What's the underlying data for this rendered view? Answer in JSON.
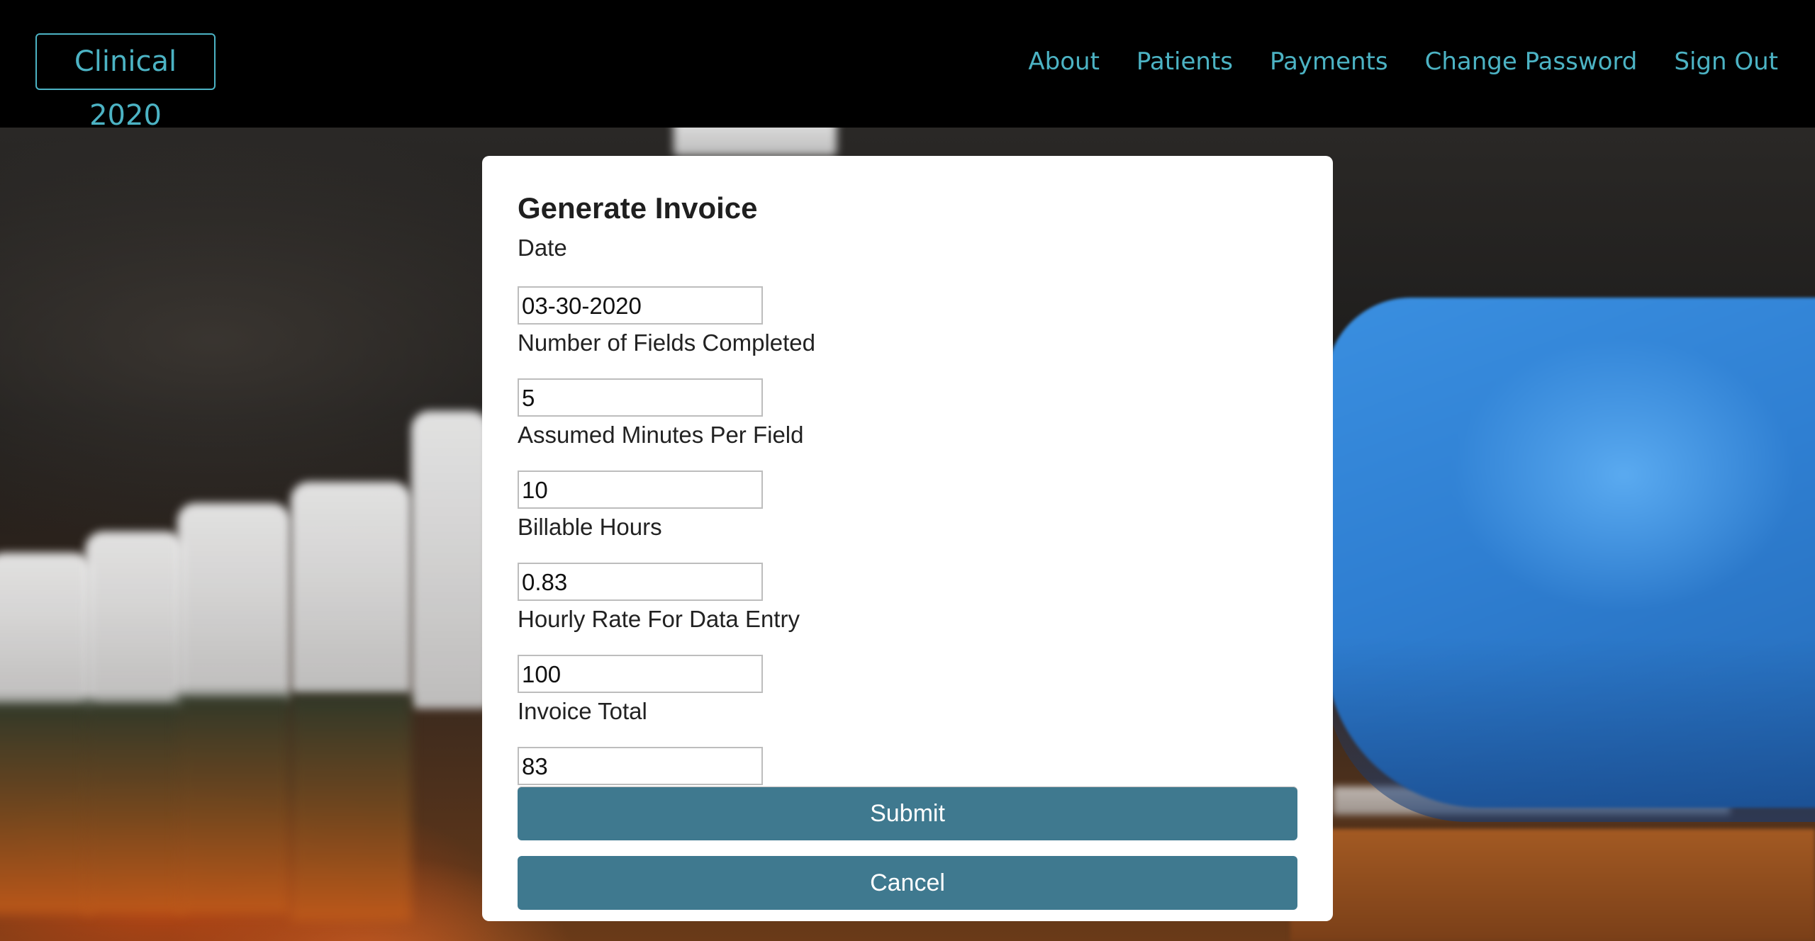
{
  "navbar": {
    "brand": "Clinical 2020",
    "links": [
      "About",
      "Patients",
      "Payments",
      "Change Password",
      "Sign Out"
    ]
  },
  "form": {
    "title": "Generate Invoice",
    "fields": [
      {
        "label": "Date",
        "value": "03-30-2020"
      },
      {
        "label": "Number of Fields Completed",
        "value": "5"
      },
      {
        "label": "Assumed Minutes Per Field",
        "value": "10"
      },
      {
        "label": "Billable Hours",
        "value": "0.83"
      },
      {
        "label": "Hourly Rate For Data Entry",
        "value": "100"
      },
      {
        "label": "Invoice Total",
        "value": "83"
      }
    ],
    "submit_label": "Submit",
    "cancel_label": "Cancel"
  },
  "colors": {
    "nav_link": "#4cb3c4",
    "button": "#3f798f"
  }
}
